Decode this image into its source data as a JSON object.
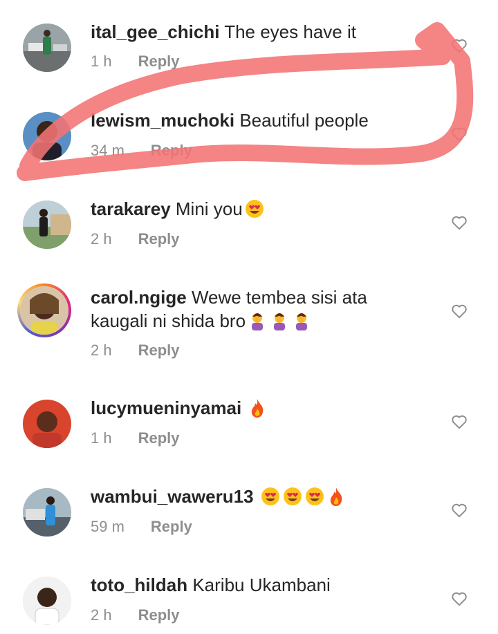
{
  "comments": [
    {
      "username": "ital_gee_chichi",
      "text": "The eyes have it",
      "text2": "",
      "time": "1 h",
      "reply": "Reply",
      "emojis": [],
      "avatar_icon": "avatar-photo-icon",
      "story_ring": false
    },
    {
      "username": "lewism_muchoki",
      "text": "Beautiful people",
      "text2": "",
      "time": "34 m",
      "reply": "Reply",
      "emojis": [],
      "avatar_icon": "avatar-photo-icon",
      "story_ring": false
    },
    {
      "username": "tarakarey",
      "text": "Mini you",
      "text2": "",
      "time": "2 h",
      "reply": "Reply",
      "emojis": [
        "heart-eyes-emoji"
      ],
      "avatar_icon": "avatar-photo-icon",
      "story_ring": false
    },
    {
      "username": "carol.ngige",
      "text": "Wewe tembea sisi ata",
      "text2": "kaugali ni shida bro",
      "time": "2 h",
      "reply": "Reply",
      "emojis": [
        "facepalm-emoji",
        "facepalm-emoji",
        "facepalm-emoji"
      ],
      "avatar_icon": "avatar-photo-icon",
      "story_ring": true
    },
    {
      "username": "lucymueninyamai",
      "text": "",
      "text2": "",
      "time": "1 h",
      "reply": "Reply",
      "emojis": [
        "fire-emoji"
      ],
      "avatar_icon": "avatar-photo-icon",
      "story_ring": false
    },
    {
      "username": "wambui_waweru13",
      "text": "",
      "text2": "",
      "time": "59 m",
      "reply": "Reply",
      "emojis": [
        "heart-eyes-emoji",
        "heart-eyes-emoji",
        "heart-eyes-emoji",
        "fire-emoji"
      ],
      "avatar_icon": "avatar-photo-icon",
      "story_ring": false
    },
    {
      "username": "toto_hildah",
      "text": "Karibu Ukambani",
      "text2": "",
      "time": "2 h",
      "reply": "Reply",
      "emojis": [],
      "avatar_icon": "avatar-photo-icon",
      "story_ring": false
    }
  ],
  "heart_icon": "heart-outline-icon",
  "annotation": {
    "color": "#f47373",
    "icon": "red-highlight-scribble"
  },
  "colors": {
    "username": "#262626",
    "meta": "#8e8e8e",
    "heart": "#8e8e8e"
  }
}
